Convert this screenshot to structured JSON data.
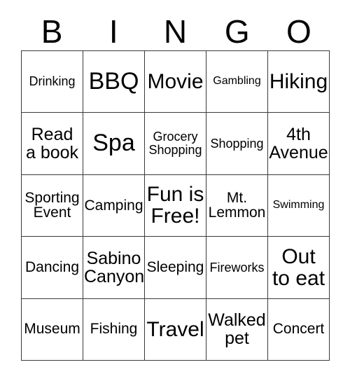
{
  "card": {
    "header": {
      "letters": [
        "B",
        "I",
        "N",
        "G",
        "O"
      ]
    },
    "grid": {
      "columns": 5,
      "rows": 5,
      "cells": [
        {
          "text": "Drinking",
          "size": "sm"
        },
        {
          "text": "BBQ",
          "size": "xxl"
        },
        {
          "text": "Movie",
          "size": "xl"
        },
        {
          "text": "Gambling",
          "size": "xs"
        },
        {
          "text": "Hiking",
          "size": "xl"
        },
        {
          "text": "Read\na book",
          "size": "lg"
        },
        {
          "text": "Spa",
          "size": "xxl"
        },
        {
          "text": "Grocery\nShopping",
          "size": "sm"
        },
        {
          "text": "Shopping",
          "size": "sm"
        },
        {
          "text": "4th\nAvenue",
          "size": "lg"
        },
        {
          "text": "Sporting\nEvent",
          "size": "md"
        },
        {
          "text": "Camping",
          "size": "md"
        },
        {
          "text": "Fun is\nFree!",
          "size": "xl"
        },
        {
          "text": "Mt.\nLemmon",
          "size": "md"
        },
        {
          "text": "Swimming",
          "size": "xs"
        },
        {
          "text": "Dancing",
          "size": "md"
        },
        {
          "text": "Sabino\nCanyon",
          "size": "lg"
        },
        {
          "text": "Sleeping",
          "size": "md"
        },
        {
          "text": "Fireworks",
          "size": "sm"
        },
        {
          "text": "Out\nto eat",
          "size": "xl"
        },
        {
          "text": "Museum",
          "size": "md"
        },
        {
          "text": "Fishing",
          "size": "md"
        },
        {
          "text": "Travel",
          "size": "xl"
        },
        {
          "text": "Walked\npet",
          "size": "lg"
        },
        {
          "text": "Concert",
          "size": "md"
        }
      ]
    },
    "colors": {
      "background": "#ffffff",
      "text": "#000000",
      "grid_line": "#3a3a3a"
    }
  }
}
